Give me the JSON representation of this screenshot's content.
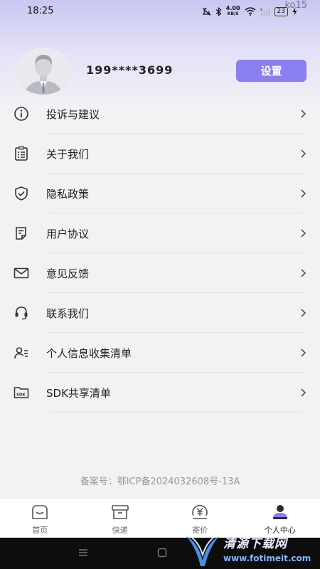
{
  "status_bar": {
    "time": "18:25",
    "net_speed": "4.00",
    "net_unit": "KB/S",
    "battery": "23",
    "corner_text": "ko15"
  },
  "profile": {
    "phone": "199****3699",
    "settings_label": "设置"
  },
  "menu": [
    {
      "label": "投诉与建议",
      "icon": "info-icon"
    },
    {
      "label": "关于我们",
      "icon": "document-list-icon"
    },
    {
      "label": "隐私政策",
      "icon": "shield-check-icon"
    },
    {
      "label": "用户协议",
      "icon": "agreement-icon"
    },
    {
      "label": "意见反馈",
      "icon": "mail-icon"
    },
    {
      "label": "联系我们",
      "icon": "headset-icon"
    },
    {
      "label": "个人信息收集清单",
      "icon": "user-list-icon"
    },
    {
      "label": "SDK共享清单",
      "icon": "sdk-folder-icon"
    }
  ],
  "footer": {
    "icp": "备案号：鄂ICP备2024032608号-13A"
  },
  "tabbar": [
    {
      "label": "首页",
      "icon": "home-icon"
    },
    {
      "label": "快递",
      "icon": "package-icon"
    },
    {
      "label": "寄价",
      "icon": "price-icon"
    },
    {
      "label": "个人中心",
      "icon": "user-center-icon",
      "active": true
    }
  ],
  "watermark": {
    "text": "清源下载网",
    "url": "www.fotimeit.com"
  },
  "colors": {
    "accent": "#8a7ff0",
    "header_gradient_top": "#c9c6f2"
  }
}
